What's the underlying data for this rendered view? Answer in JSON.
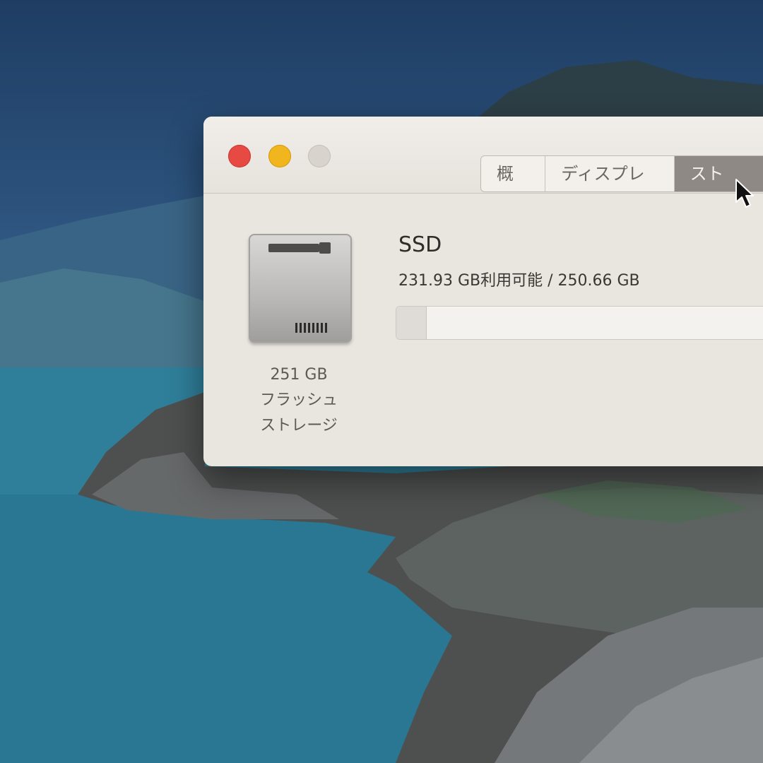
{
  "window": {
    "tabs": [
      {
        "label": "概要",
        "active": false
      },
      {
        "label": "ディスプレイ",
        "active": false
      },
      {
        "label": "ストレ",
        "active": true
      }
    ]
  },
  "storage": {
    "drive_size": "251 GB",
    "drive_type_line1": "フラッシュ",
    "drive_type_line2": "ストレージ",
    "volume_name": "SSD",
    "capacity_text": "231.93 GB利用可能 / 250.66 GB",
    "used_fraction": 0.075
  },
  "colors": {
    "close": "#e74a43",
    "minimize": "#f1b51e",
    "active_tab": "#8e8984"
  },
  "icons": [
    "close-icon",
    "minimize-icon",
    "zoom-icon",
    "flash-storage-icon",
    "mouse-pointer-icon"
  ]
}
